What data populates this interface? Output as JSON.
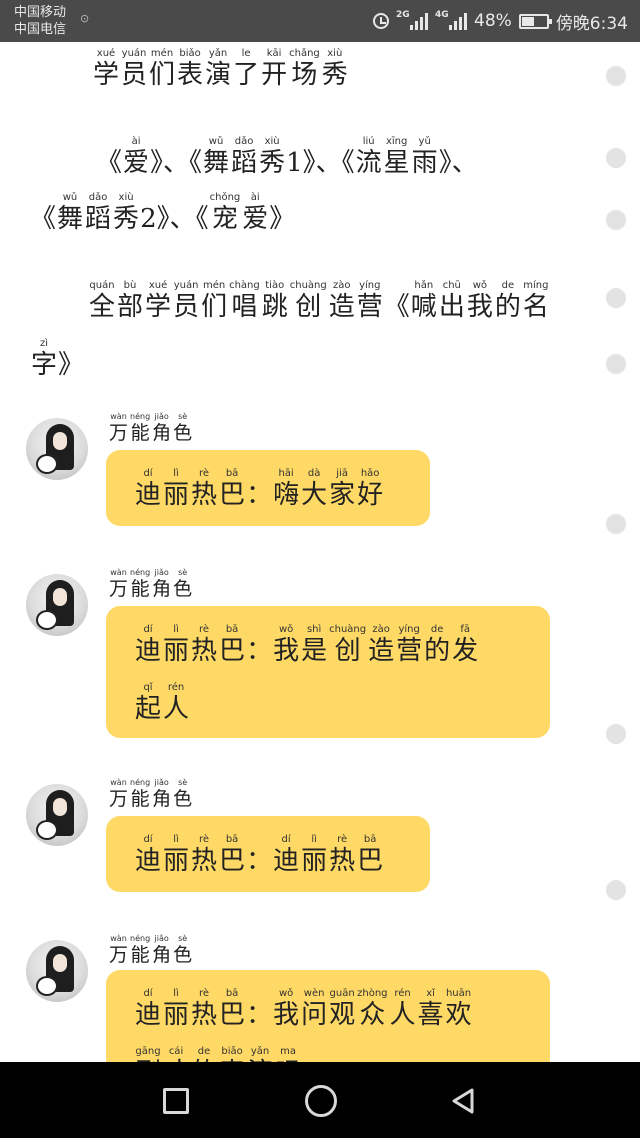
{
  "status_bar": {
    "carrier_1": "中国移动",
    "carrier_2": "中国电信",
    "carrier_extra": "⊙",
    "net_1": "2G",
    "net_2": "4G",
    "battery": "48%",
    "time": "傍晚6:34"
  },
  "intro": {
    "line1": [
      [
        "xué",
        "学"
      ],
      [
        "yuán",
        "员"
      ],
      [
        "mén",
        "们"
      ],
      [
        "biǎo",
        "表"
      ],
      [
        "yǎn",
        "演"
      ],
      [
        "le",
        "了"
      ],
      [
        "kāi",
        "开"
      ],
      [
        "chǎng",
        "场"
      ],
      [
        "xiù",
        "秀"
      ]
    ],
    "line2": [
      [
        "",
        "《"
      ],
      [
        "ài",
        "爱"
      ],
      [
        "",
        "》、《"
      ],
      [
        "wǔ",
        "舞"
      ],
      [
        "dǎo",
        "蹈"
      ],
      [
        "xiù",
        "秀"
      ],
      [
        "",
        "1》、《"
      ],
      [
        "liú",
        "流"
      ],
      [
        "xīng",
        "星"
      ],
      [
        "yǔ",
        "雨"
      ],
      [
        "",
        "》、"
      ]
    ],
    "line3": [
      [
        "",
        "《"
      ],
      [
        "wǔ",
        "舞"
      ],
      [
        "dǎo",
        "蹈"
      ],
      [
        "xiù",
        "秀"
      ],
      [
        "",
        "2》、《"
      ],
      [
        "chǒng",
        "宠"
      ],
      [
        "ài",
        "爱"
      ],
      [
        "",
        "》"
      ]
    ],
    "line4": [
      [
        "quán",
        "全"
      ],
      [
        "bù",
        "部"
      ],
      [
        "xué",
        "学"
      ],
      [
        "yuán",
        "员"
      ],
      [
        "mén",
        "们"
      ],
      [
        "chàng",
        "唱"
      ],
      [
        "tiào",
        "跳"
      ],
      [
        "chuàng",
        "创"
      ],
      [
        "zào",
        "造"
      ],
      [
        "yíng",
        "营"
      ],
      [
        "",
        "《"
      ],
      [
        "hǎn",
        "喊"
      ],
      [
        "chū",
        "出"
      ],
      [
        "wǒ",
        "我"
      ],
      [
        "de",
        "的"
      ],
      [
        "míng",
        "名"
      ]
    ],
    "line5": [
      [
        "zì",
        "字"
      ],
      [
        "",
        "》"
      ]
    ]
  },
  "messages": [
    {
      "sender": [
        [
          "wàn",
          "万"
        ],
        [
          "néng",
          "能"
        ],
        [
          "jiǎo",
          "角"
        ],
        [
          "sè",
          "色"
        ]
      ],
      "lines": [
        [
          [
            "dí",
            "迪"
          ],
          [
            "lì",
            "丽"
          ],
          [
            "rè",
            "热"
          ],
          [
            "bā",
            "巴"
          ],
          [
            "",
            "："
          ],
          [
            "hāi",
            "嗨"
          ],
          [
            "dà",
            "大"
          ],
          [
            "jiā",
            "家"
          ],
          [
            "hǎo",
            "好"
          ]
        ]
      ]
    },
    {
      "sender": [
        [
          "wàn",
          "万"
        ],
        [
          "néng",
          "能"
        ],
        [
          "jiǎo",
          "角"
        ],
        [
          "sè",
          "色"
        ]
      ],
      "lines": [
        [
          [
            "dí",
            "迪"
          ],
          [
            "lì",
            "丽"
          ],
          [
            "rè",
            "热"
          ],
          [
            "bā",
            "巴"
          ],
          [
            "",
            "："
          ],
          [
            "wǒ",
            "我"
          ],
          [
            "shì",
            "是"
          ],
          [
            "chuàng",
            "创"
          ],
          [
            "zào",
            "造"
          ],
          [
            "yíng",
            "营"
          ],
          [
            "de",
            "的"
          ],
          [
            "fā",
            "发"
          ]
        ],
        [
          [
            "qǐ",
            "起"
          ],
          [
            "rén",
            "人"
          ]
        ]
      ]
    },
    {
      "sender": [
        [
          "wàn",
          "万"
        ],
        [
          "néng",
          "能"
        ],
        [
          "jiǎo",
          "角"
        ],
        [
          "sè",
          "色"
        ]
      ],
      "lines": [
        [
          [
            "dí",
            "迪"
          ],
          [
            "lì",
            "丽"
          ],
          [
            "rè",
            "热"
          ],
          [
            "bā",
            "巴"
          ],
          [
            "",
            "："
          ],
          [
            "dí",
            "迪"
          ],
          [
            "lì",
            "丽"
          ],
          [
            "rè",
            "热"
          ],
          [
            "bā",
            "巴"
          ]
        ]
      ]
    },
    {
      "sender": [
        [
          "wàn",
          "万"
        ],
        [
          "néng",
          "能"
        ],
        [
          "jiǎo",
          "角"
        ],
        [
          "sè",
          "色"
        ]
      ],
      "lines": [
        [
          [
            "dí",
            "迪"
          ],
          [
            "lì",
            "丽"
          ],
          [
            "rè",
            "热"
          ],
          [
            "bā",
            "巴"
          ],
          [
            "",
            "："
          ],
          [
            "wǒ",
            "我"
          ],
          [
            "wèn",
            "问"
          ],
          [
            "guān",
            "观"
          ],
          [
            "zhòng",
            "众"
          ],
          [
            "rén",
            "人"
          ],
          [
            "xǐ",
            "喜"
          ],
          [
            "huān",
            "欢"
          ]
        ],
        [
          [
            "gāng",
            "刚"
          ],
          [
            "cái",
            "才"
          ],
          [
            "de",
            "的"
          ],
          [
            "biǎo",
            "表"
          ],
          [
            "yǎn",
            "演"
          ],
          [
            "ma",
            "吗"
          ]
        ]
      ]
    }
  ],
  "colors": {
    "bubble": "#ffd966",
    "status_bar": "#4a4a4a",
    "nav_bar": "#000000",
    "unread_dot": "#e3e3e3"
  }
}
